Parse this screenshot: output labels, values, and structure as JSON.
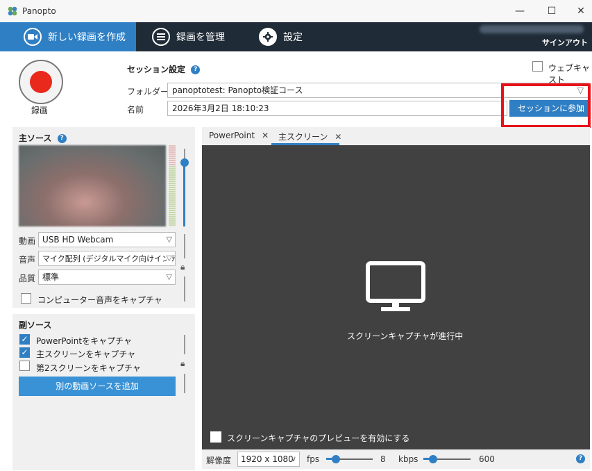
{
  "window": {
    "title": "Panopto",
    "minimize": "—",
    "maximize": "☐",
    "close": "✕"
  },
  "nav": {
    "tabs": [
      {
        "label": "新しい録画を作成"
      },
      {
        "label": "録画を管理"
      },
      {
        "label": "設定"
      }
    ],
    "signout": "サインアウト"
  },
  "record": {
    "label": "録画"
  },
  "session": {
    "title": "セッション設定",
    "folder_label": "フォルダー",
    "folder_value": "panoptotest: Panopto検証コース",
    "name_label": "名前",
    "name_value": "2026年3月2日 18:10:23",
    "webcast_label": "ウェブキャスト",
    "join_label": "セッションに参加"
  },
  "primary": {
    "title": "主ソース",
    "video_label": "動画",
    "video_value": "USB HD Webcam",
    "audio_label": "音声",
    "audio_value": "マイク配列 (デジタルマイク向けインテ",
    "quality_label": "品質",
    "quality_value": "標準",
    "computer_audio": "コンピューター音声をキャプチャ"
  },
  "secondary": {
    "title": "副ソース",
    "items": [
      {
        "label": "PowerPointをキャプチャ",
        "checked": true
      },
      {
        "label": "主スクリーンをキャプチャ",
        "checked": true
      },
      {
        "label": "第2スクリーンをキャプチャ",
        "checked": false
      }
    ],
    "add_button": "別の動画ソースを追加"
  },
  "content": {
    "tabs": [
      {
        "label": "PowerPoint"
      },
      {
        "label": "主スクリーン"
      }
    ],
    "status": "スクリーンキャプチャが進行中",
    "preview_label": "スクリーンキャプチャのプレビューを有効にする"
  },
  "bottom": {
    "resolution_label": "解像度",
    "resolution_value": "1920 x 1080",
    "fps_label": "fps",
    "fps_value": "8",
    "kbps_label": "kbps",
    "kbps_value": "600"
  },
  "colors": {
    "accent": "#2f7fc4",
    "nav_bg": "#1f2b37",
    "record": "#e8291c",
    "highlight": "#e8121a"
  }
}
